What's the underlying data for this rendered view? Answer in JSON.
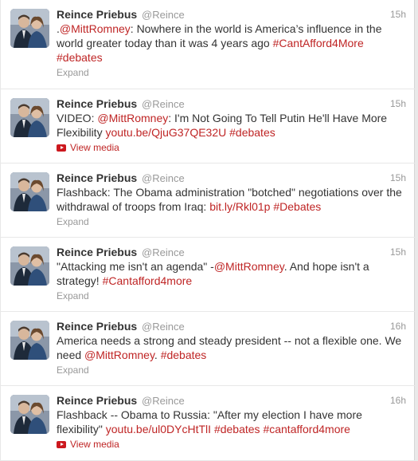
{
  "account": {
    "fullname": "Reince Priebus",
    "username": "@Reince"
  },
  "colors": {
    "link": "#bf2525",
    "muted": "#999999",
    "text": "#333333"
  },
  "tweets": [
    {
      "time": "15h",
      "segments": [
        {
          "text": ".",
          "link": false
        },
        {
          "text": "@MittRomney",
          "link": true
        },
        {
          "text": ": Nowhere in the world is America’s influence in the world greater today than it was 4 years ago ",
          "link": false
        },
        {
          "text": "#CantAfford4More",
          "link": true
        },
        {
          "text": " ",
          "link": false
        },
        {
          "text": "#debates",
          "link": true
        }
      ],
      "action": "Expand",
      "action_icon": ""
    },
    {
      "time": "15h",
      "segments": [
        {
          "text": "VIDEO: ",
          "link": false
        },
        {
          "text": "@MittRomney",
          "link": true
        },
        {
          "text": ": I'm Not Going To Tell Putin He'll Have More Flexibility ",
          "link": false
        },
        {
          "text": "youtu.be/QjuG37QE32U",
          "link": true
        },
        {
          "text": " ",
          "link": false
        },
        {
          "text": "#debates",
          "link": true
        }
      ],
      "action": "View media",
      "action_icon": "youtube-icon"
    },
    {
      "time": "15h",
      "segments": [
        {
          "text": "Flashback: The Obama administration \"botched\" negotiations over the withdrawal of troops from Iraq: ",
          "link": false
        },
        {
          "text": "bit.ly/Rkl01p",
          "link": true
        },
        {
          "text": " ",
          "link": false
        },
        {
          "text": "#Debates",
          "link": true
        }
      ],
      "action": "Expand",
      "action_icon": ""
    },
    {
      "time": "15h",
      "segments": [
        {
          "text": "\"Attacking me isn't an agenda\" -",
          "link": false
        },
        {
          "text": "@MittRomney",
          "link": true
        },
        {
          "text": ". And hope isn't a strategy! ",
          "link": false
        },
        {
          "text": "#Cantafford4more",
          "link": true
        }
      ],
      "action": "Expand",
      "action_icon": ""
    },
    {
      "time": "16h",
      "segments": [
        {
          "text": "America needs a strong and steady president -- not a flexible one. We need ",
          "link": false
        },
        {
          "text": "@MittRomney",
          "link": true
        },
        {
          "text": ". ",
          "link": false
        },
        {
          "text": "#debates",
          "link": true
        }
      ],
      "action": "Expand",
      "action_icon": ""
    },
    {
      "time": "16h",
      "segments": [
        {
          "text": "Flashback -- Obama to Russia: \"After my election I have more flexibility\" ",
          "link": false
        },
        {
          "text": "youtu.be/ul0DYcHtTlI",
          "link": true
        },
        {
          "text": " ",
          "link": false
        },
        {
          "text": "#debates",
          "link": true
        },
        {
          "text": " ",
          "link": false
        },
        {
          "text": "#cantafford4more",
          "link": true
        }
      ],
      "action": "View media",
      "action_icon": "youtube-icon"
    }
  ]
}
